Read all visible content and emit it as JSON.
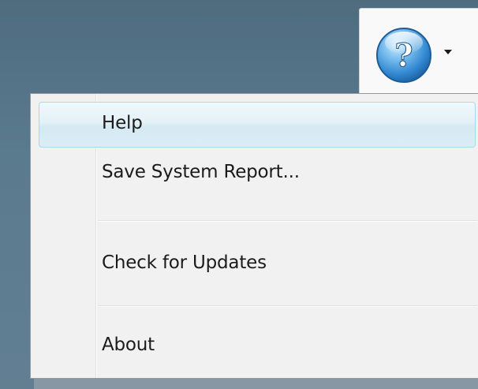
{
  "toolbar": {
    "help_button_icon": "help-question-icon",
    "dropdown_icon": "caret-down-icon"
  },
  "menu": {
    "items": [
      {
        "label": "Help",
        "highlighted": true
      },
      {
        "label": "Save System Report..."
      },
      {
        "label": "Check for Updates"
      },
      {
        "label": "About"
      }
    ]
  },
  "colors": {
    "background": "#5a7a8e",
    "menu_background": "#f1f1f1",
    "highlight_border": "#a8d8eb",
    "icon_blue": "#3b8fd0"
  }
}
